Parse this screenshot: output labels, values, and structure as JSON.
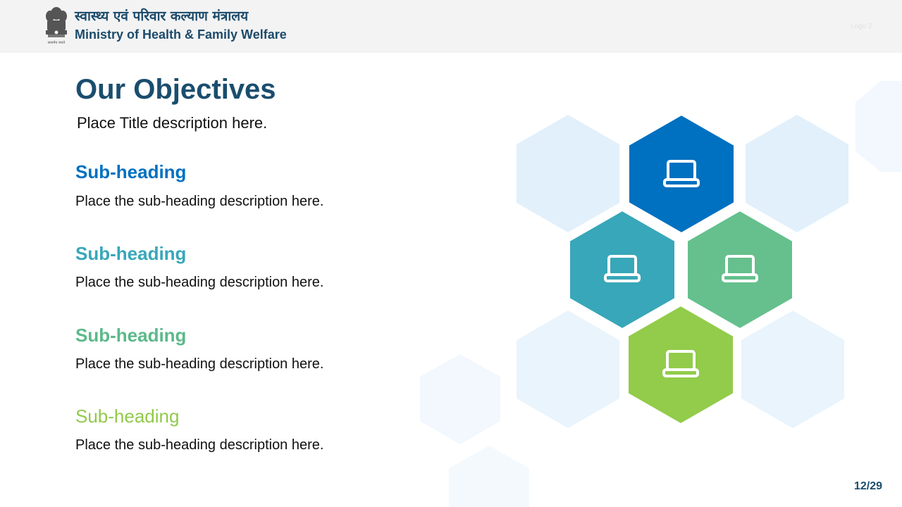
{
  "header": {
    "hindi_title": "स्वास्थ्य एवं परिवार कल्याण मंत्रालय",
    "english_title": "Ministry of Health & Family Welfare",
    "logo2_label": "Logo 2",
    "emblem_motto": "सत्यमेव जयते"
  },
  "main": {
    "title": "Our Objectives",
    "title_description": "Place Title description here.",
    "items": [
      {
        "heading": "Sub-heading",
        "description": "Place the sub-heading description here.",
        "color": "#0070c0"
      },
      {
        "heading": "Sub-heading",
        "description": "Place the sub-heading description here.",
        "color": "#38a7b9"
      },
      {
        "heading": "Sub-heading",
        "description": "Place the sub-heading description here.",
        "color": "#5cb98a"
      },
      {
        "heading": "Sub-heading",
        "description": "Place the sub-heading description here.",
        "color": "#92c94b"
      }
    ]
  },
  "hex_graphic": {
    "icon": "laptop-icon",
    "colors": [
      "#0070c0",
      "#38a7b9",
      "#65c08d",
      "#92cc4a"
    ],
    "light_color": "#e1f0fb"
  },
  "footer": {
    "page_number": "12/29"
  }
}
